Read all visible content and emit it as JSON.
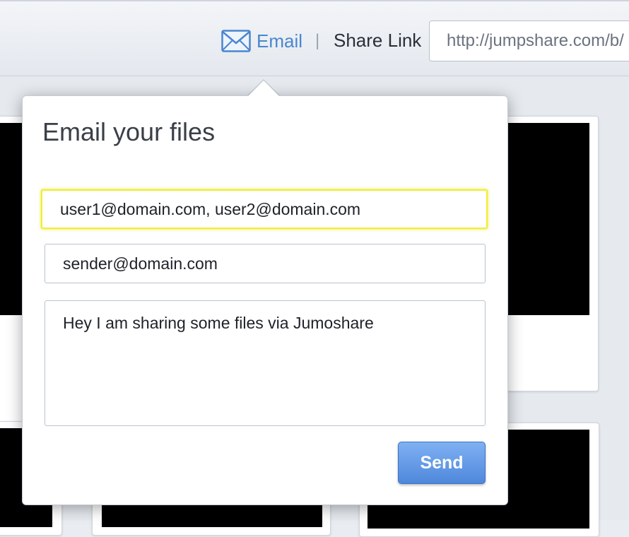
{
  "toolbar": {
    "email_label": "Email",
    "separator": "|",
    "share_label": "Share Link",
    "share_link_value": "http://jumpshare.com/b/"
  },
  "popover": {
    "title": "Email your files",
    "to_value": "user1@domain.com, user2@domain.com",
    "from_value": "sender@domain.com",
    "message_value": "Hey I am sharing some files via Jumoshare",
    "send_label": "Send"
  },
  "colors": {
    "link_blue": "#4a86cf",
    "focus_yellow": "#f0ee3a",
    "send_button": "#5b93e3"
  }
}
